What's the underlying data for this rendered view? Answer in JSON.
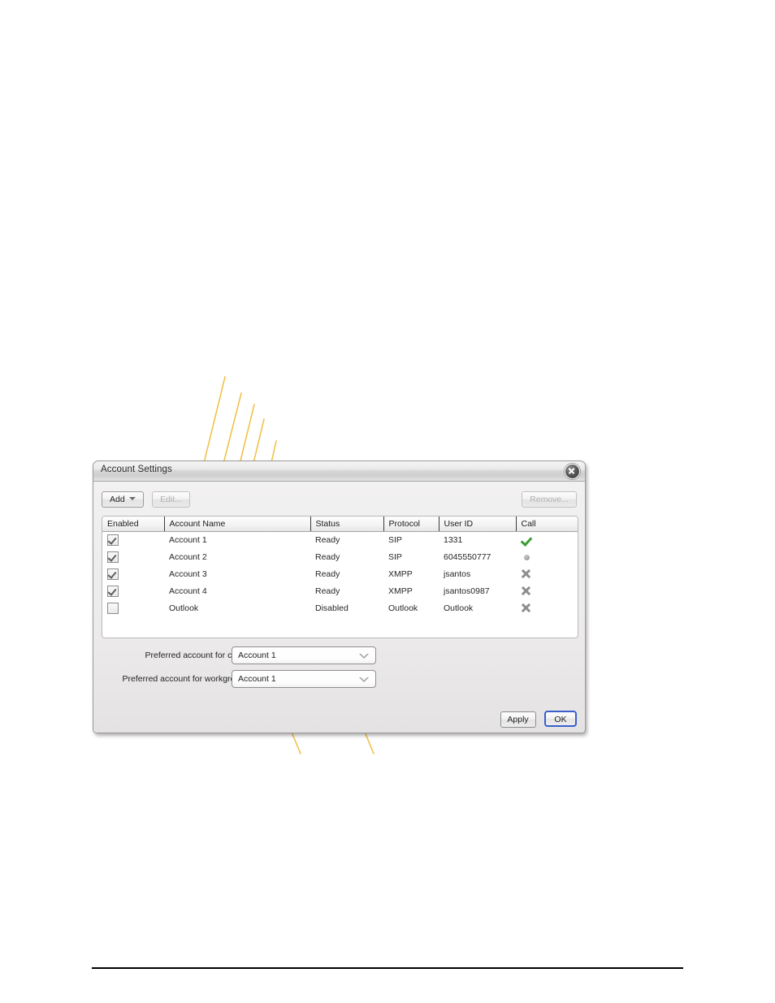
{
  "dialog": {
    "title": "Account Settings",
    "close_icon": "close-circle-icon",
    "toolbar": {
      "add_label": "Add",
      "edit_label": "Edit...",
      "remove_label": "Remove..."
    },
    "table": {
      "columns": [
        "Enabled",
        "Account Name",
        "Status",
        "Protocol",
        "User ID",
        "Call"
      ],
      "rows": [
        {
          "enabled": true,
          "name": "Account 1",
          "status": "Ready",
          "protocol": "SIP",
          "user_id": "1331",
          "call_icon": "green-check-icon"
        },
        {
          "enabled": true,
          "name": "Account 2",
          "status": "Ready",
          "protocol": "SIP",
          "user_id": "6045550777",
          "call_icon": "gray-dot-icon"
        },
        {
          "enabled": true,
          "name": "Account 3",
          "status": "Ready",
          "protocol": "XMPP",
          "user_id": "jsantos",
          "call_icon": "gray-x-icon"
        },
        {
          "enabled": true,
          "name": "Account 4",
          "status": "Ready",
          "protocol": "XMPP",
          "user_id": "jsantos0987",
          "call_icon": "gray-x-icon"
        },
        {
          "enabled": false,
          "name": "Outlook",
          "status": "Disabled",
          "protocol": "Outlook",
          "user_id": "Outlook",
          "call_icon": "gray-x-icon"
        }
      ]
    },
    "preferences": [
      {
        "label": "Preferred account for calls:",
        "value": "Account 1"
      },
      {
        "label": "Preferred account for workgroup:",
        "value": "Account 1"
      }
    ],
    "footer": {
      "apply_label": "Apply",
      "ok_label": "OK"
    }
  },
  "annotation": {
    "line_color": "#f2c14a",
    "count": 7
  }
}
